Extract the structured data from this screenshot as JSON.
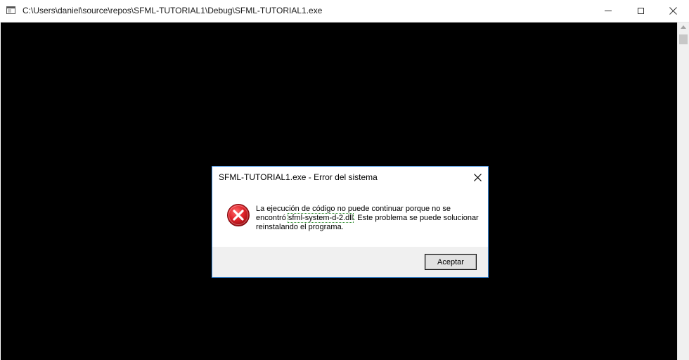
{
  "window": {
    "title": "C:\\Users\\daniel\\source\\repos\\SFML-TUTORIAL1\\Debug\\SFML-TUTORIAL1.exe",
    "icons": {
      "app": "console-app-icon",
      "minimize": "minimize-icon",
      "maximize": "maximize-icon",
      "close": "close-icon"
    },
    "client_background": "#000000"
  },
  "dialog": {
    "title": "SFML-TUTORIAL1.exe - Error del sistema",
    "icon": "error-icon",
    "message_before": "La ejecución de código no puede continuar porque no se encontró ",
    "dll_name": "sfml-system-d-2.dll",
    "message_after": ". Este problema se puede solucionar reinstalando el programa.",
    "ok_label": "Aceptar",
    "accent_color": "#3b8de0",
    "error_color": "#e81123"
  }
}
